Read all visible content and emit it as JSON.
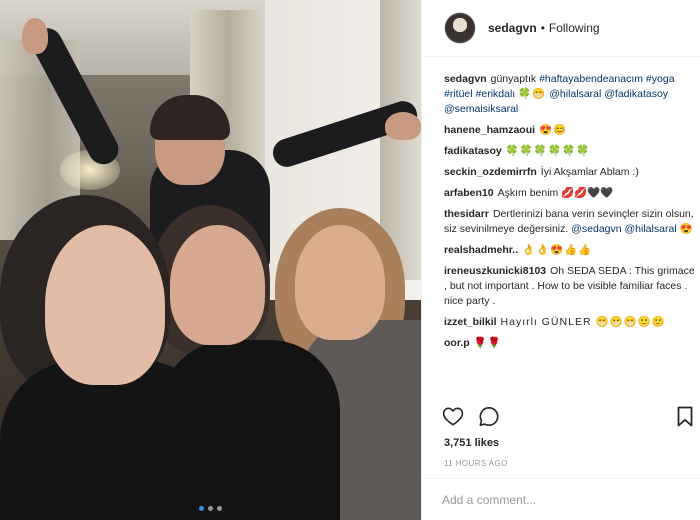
{
  "post": {
    "username": "sedagvn",
    "follow_state": "Following",
    "caption_user": "sedagvn",
    "caption_text": "günyaptık",
    "caption_tags": [
      "#haftayabendeanacım",
      "#yoga",
      "#ritüel",
      "#erikdalı"
    ],
    "caption_emoji": "🍀😁",
    "caption_mentions": [
      "@hilalsaral",
      "@fadikatasoy",
      "@semaisiksaral"
    ],
    "likes": "3,751 likes",
    "time": "11 HOURS AGO",
    "carousel_count": 3,
    "carousel_active": 0
  },
  "comments": [
    {
      "user": "hanene_hamzaoui",
      "text": "😍😊"
    },
    {
      "user": "fadikatasoy",
      "text": "🍀🍀🍀🍀🍀🍀"
    },
    {
      "user": "seckin_ozdemirrfn",
      "text": "İyi Akşamlar Ablam :)"
    },
    {
      "user": "arfaben10",
      "text": "Aşkım benim 💋💋🖤🖤"
    },
    {
      "user": "thesidarr",
      "text": "Dertlerinizi bana verin sevinçler sizin olsun, siz sevinilmeye değersiniz.",
      "mention": "@sedagvn",
      "mention2": "@hilalsaral",
      "emoji": "😍"
    },
    {
      "user": "realshadmehr..",
      "text": "👌👌😍👍👍"
    },
    {
      "user": "ireneuszkunicki8103",
      "text": "Oh SEDA SEDA : This grimace , but not important . How to be visible familiar faces . nice party ."
    },
    {
      "user": "izzet_bilkil",
      "text": "Hayırlı GÜNLER 😁😁😁🙂🙂"
    },
    {
      "user": "oor.p",
      "text": "🌹🌹"
    }
  ],
  "add_comment": {
    "placeholder": "Add a comment..."
  },
  "icons": [
    "heart-icon",
    "comment-icon",
    "bookmark-icon"
  ],
  "colors": {
    "link": "#003569",
    "muted": "#999999",
    "carousel_active": "#3a8fe0"
  }
}
